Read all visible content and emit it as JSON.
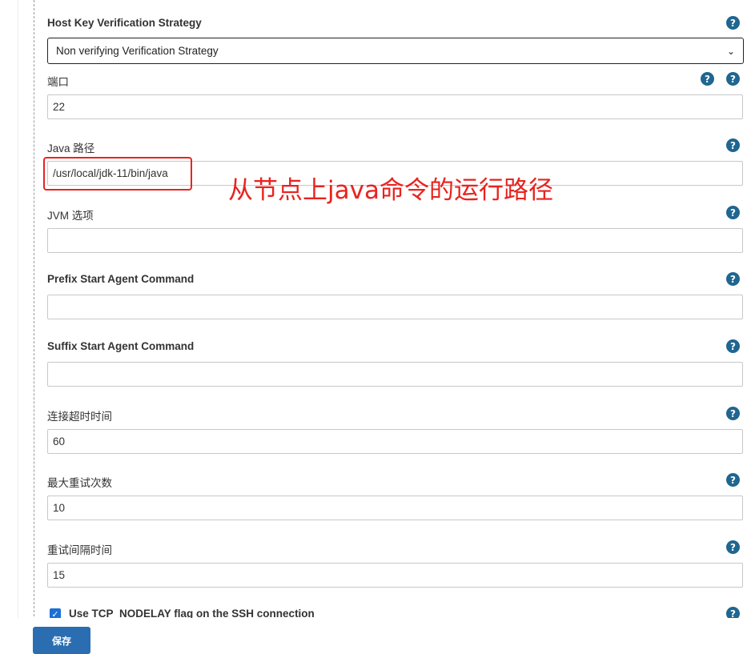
{
  "form": {
    "host_key": {
      "label": "Host Key Verification Strategy",
      "selected": "Non verifying Verification Strategy",
      "help_icon": "question-circle-icon"
    },
    "port": {
      "label": "端口",
      "value": "22"
    },
    "java_path": {
      "label": "Java 路径",
      "value": "/usr/local/jdk-11/bin/java"
    },
    "jvm_options": {
      "label": "JVM 选项",
      "value": ""
    },
    "prefix_cmd": {
      "label": "Prefix Start Agent Command",
      "value": ""
    },
    "suffix_cmd": {
      "label": "Suffix Start Agent Command",
      "value": ""
    },
    "connect_timeout": {
      "label": "连接超时时间",
      "value": "60"
    },
    "max_retries": {
      "label": "最大重试次数",
      "value": "10"
    },
    "retry_wait": {
      "label": "重试间隔时间",
      "value": "15"
    },
    "tcp_nodelay": {
      "label": "Use TCP_NODELAY flag on the SSH connection",
      "checked": true
    }
  },
  "annotation": {
    "text": "从节点上java命令的运行路径",
    "color": "#e8231f"
  },
  "buttons": {
    "save_label": "保存"
  },
  "colors": {
    "help_icon": "#1f6690",
    "save_button": "#2a6db1",
    "checkbox": "#1b6fd6"
  }
}
